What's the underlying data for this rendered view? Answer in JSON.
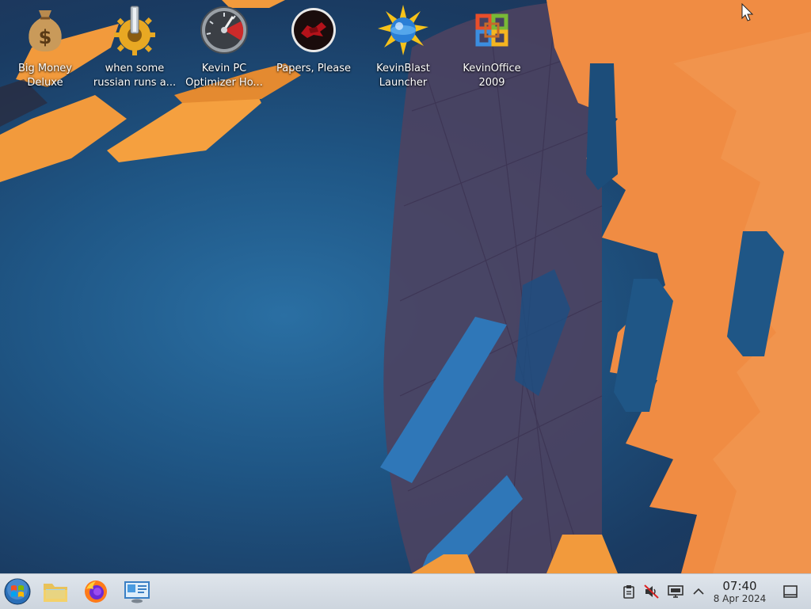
{
  "desktop": {
    "icons": [
      {
        "label": "Big Money\nDeluxe",
        "icon": "money-bag-icon"
      },
      {
        "label": "when some\nrussian runs a...",
        "icon": "gear-icon"
      },
      {
        "label": "Kevin PC\nOptimizer Ho...",
        "icon": "speedometer-icon"
      },
      {
        "label": "Papers, Please",
        "icon": "papers-please-icon"
      },
      {
        "label": "KevinBlast\nLauncher",
        "icon": "kevinblast-icon"
      },
      {
        "label": "KevinOffice\n2009",
        "icon": "office-logo-icon"
      }
    ]
  },
  "taskbar": {
    "pinned": [
      {
        "icon": "start-menu-icon"
      },
      {
        "icon": "file-manager-icon"
      },
      {
        "icon": "firefox-icon"
      },
      {
        "icon": "remote-desktop-icon"
      }
    ],
    "tray": [
      {
        "icon": "clipboard-icon"
      },
      {
        "icon": "volume-muted-icon"
      },
      {
        "icon": "display-icon"
      },
      {
        "icon": "chevron-up-icon"
      }
    ],
    "clock": {
      "time": "07:40",
      "date": "8 Apr 2024"
    }
  }
}
